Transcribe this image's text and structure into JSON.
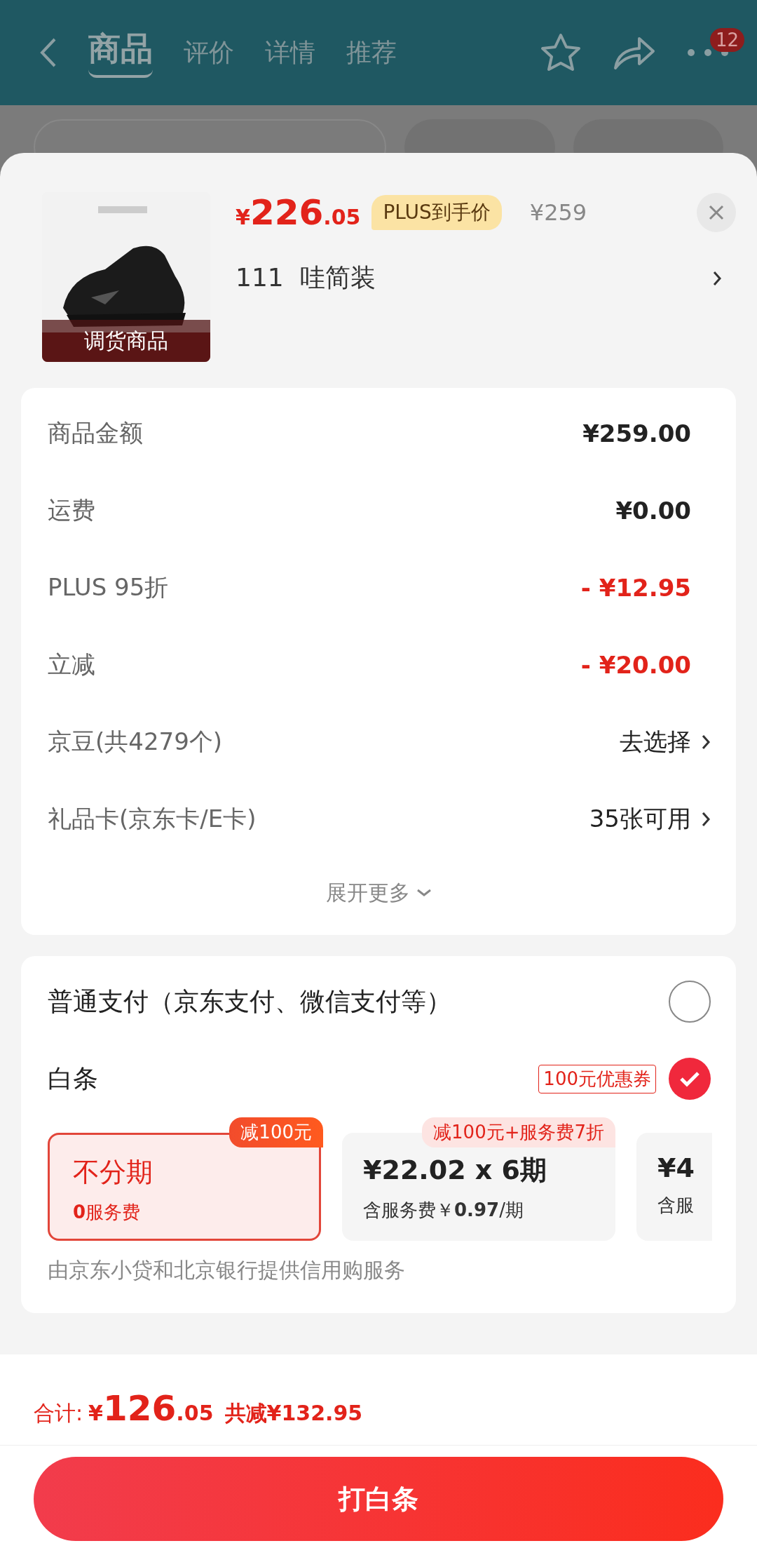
{
  "header": {
    "tabs": [
      {
        "label": "商品",
        "selected": true
      },
      {
        "label": "评价",
        "selected": false
      },
      {
        "label": "详情",
        "selected": false
      },
      {
        "label": "推荐",
        "selected": false
      }
    ],
    "badge": "12"
  },
  "product": {
    "image_label": "调货商品",
    "price_symbol": "¥",
    "price_int": "226",
    "price_dec": ".05",
    "price_tag": "PLUS到手价",
    "original_price": "¥259",
    "variant": "111  哇简装"
  },
  "costs": [
    {
      "label": "商品金额",
      "value": "¥259.00",
      "kind": "amount"
    },
    {
      "label": "运费",
      "value": "¥0.00",
      "kind": "amount"
    },
    {
      "label": "PLUS 95折",
      "value": "- ¥12.95",
      "kind": "discount"
    },
    {
      "label": "立减",
      "value": "- ¥20.00",
      "kind": "discount"
    },
    {
      "label": "京豆(共4279个)",
      "value": "去选择",
      "kind": "link"
    },
    {
      "label": "礼品卡(京东卡/E卡)",
      "value": "35张可用",
      "kind": "link"
    }
  ],
  "expand": "展开更多",
  "payments": [
    {
      "label": "普通支付（京东支付、微信支付等）",
      "selected": false
    },
    {
      "label": "白条",
      "coupon": "100元优惠券",
      "selected": true
    }
  ],
  "plans": [
    {
      "title": "不分期",
      "fee_strong": "0",
      "fee": "服务费",
      "tag": "减100元",
      "selected": true
    },
    {
      "title": "¥22.02 x 6期",
      "fee": "含服务费￥",
      "fee_strong": "0.97",
      "fee_after": "/期",
      "tag": "减100元+服务费7折",
      "selected": false
    },
    {
      "title": "¥4",
      "fee": "含服",
      "selected": false
    }
  ],
  "provider_note": "由京东小贷和北京银行提供信用购服务",
  "total": {
    "label": "合计:",
    "symbol": "¥",
    "int": "126",
    "dec": ".05",
    "saved": "共减¥132.95"
  },
  "submit": "打白条"
}
